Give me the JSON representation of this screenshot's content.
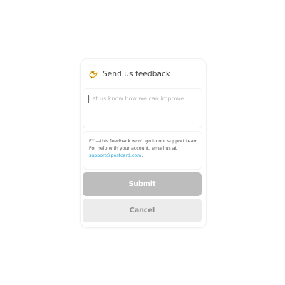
{
  "dialog": {
    "title": "Send us feedback",
    "icon": "bird-icon"
  },
  "feedback_input": {
    "placeholder": "Let us know how we can improve.",
    "value": ""
  },
  "info": {
    "line1": "FYI—this feedback won't go to our support team.",
    "line2": "For help with your account, email us at",
    "support_email": "support@postcard.com",
    "trailing": "."
  },
  "buttons": {
    "submit_label": "Submit",
    "cancel_label": "Cancel"
  },
  "colors": {
    "accent_link": "#1a9fd9",
    "submit_bg": "#bdbdbd",
    "cancel_bg": "#ececec",
    "icon_color": "#e0a100"
  }
}
